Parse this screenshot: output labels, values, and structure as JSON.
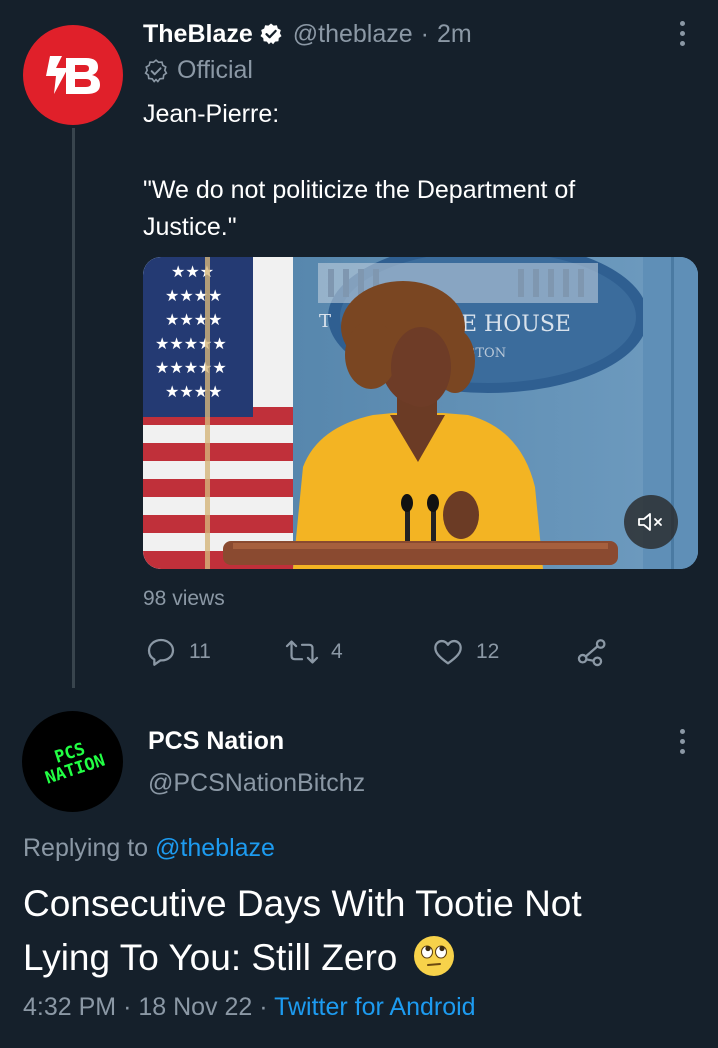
{
  "tweet": {
    "author_name": "TheBlaze",
    "handle": "@theblaze",
    "separator": "·",
    "time": "2m",
    "badge_label": "Official",
    "text_line1": "Jean-Pierre:",
    "text_line2": "\"We do not politicize the Department of",
    "text_line3": "Justice.\"",
    "video_backdrop_text1": "E HOUSE",
    "video_backdrop_text2": "GTON",
    "video_backdrop_text3": "T",
    "views": "98 views",
    "actions": {
      "replies": "11",
      "retweets": "4",
      "likes": "12"
    }
  },
  "reply": {
    "author_name": "PCS Nation",
    "handle": "@PCSNationBitchz",
    "avatar_text_line1": "PCS",
    "avatar_text_line2": "NATION",
    "replying_prefix": "Replying to",
    "replying_handle": "@theblaze",
    "text_line1": "Consecutive Days With Tootie Not",
    "text_line2": "Lying To You: Still Zero",
    "time": "4:32 PM",
    "separator1": "·",
    "date": "18 Nov 22",
    "separator2": "·",
    "client": "Twitter for Android"
  },
  "colors": {
    "background": "#15202b",
    "muted": "#8b98a5",
    "link": "#1d9bf0",
    "blaze_red": "#e0202a",
    "pcs_green": "#22ff44"
  }
}
